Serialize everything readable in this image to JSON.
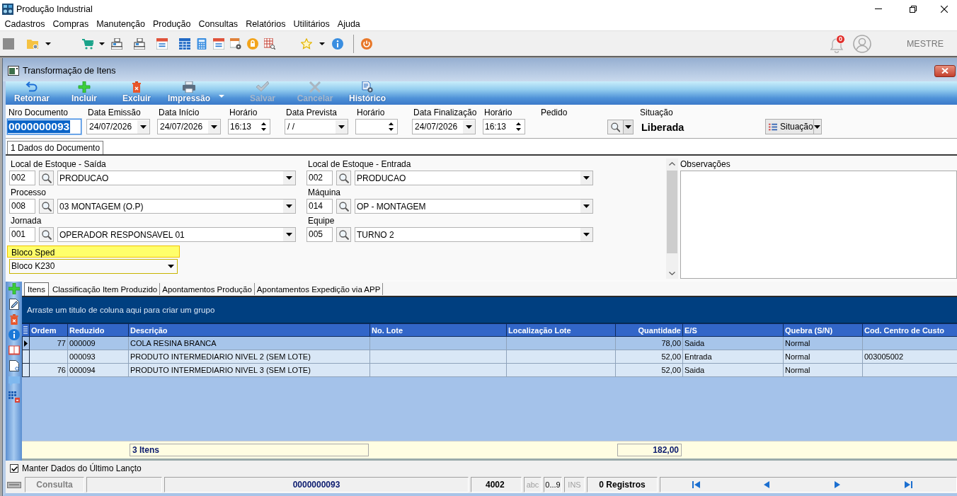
{
  "window": {
    "title": "Produção Industrial"
  },
  "menu": [
    "Cadastros",
    "Compras",
    "Manutenção",
    "Produção",
    "Consultas",
    "Relatórios",
    "Utilitários",
    "Ajuda"
  ],
  "user_area": {
    "notification_count": "0",
    "user_name": "MESTRE"
  },
  "document_window": {
    "title": "Transformação de Itens",
    "actions": [
      {
        "kind": "return",
        "label": "Retornar",
        "disabled": false,
        "dropdown": false
      },
      {
        "kind": "add",
        "label": "Incluir",
        "disabled": false,
        "dropdown": false
      },
      {
        "kind": "delete",
        "label": "Excluir",
        "disabled": false,
        "dropdown": false
      },
      {
        "kind": "print",
        "label": "Impressão",
        "disabled": false,
        "dropdown": true
      },
      {
        "kind": "save",
        "label": "Salvar",
        "disabled": true,
        "dropdown": false
      },
      {
        "kind": "cancel",
        "label": "Cancelar",
        "disabled": true,
        "dropdown": false
      },
      {
        "kind": "history",
        "label": "Histórico",
        "disabled": false,
        "dropdown": false
      }
    ]
  },
  "header": {
    "fields": [
      {
        "kind": "text",
        "label": "Nro Documento",
        "value": "0000000093",
        "focused": true
      },
      {
        "kind": "date",
        "label": "Data Emissão",
        "value": "24/07/2026",
        "focused": false
      },
      {
        "kind": "date",
        "label": "Data Início",
        "value": "24/07/2026",
        "focused": false
      },
      {
        "kind": "time",
        "label": "Horário",
        "value": "16:13",
        "focused": false
      },
      {
        "kind": "date",
        "label": "Data Prevista",
        "value": "/ /",
        "focused": false
      },
      {
        "kind": "time",
        "label": "Horário",
        "focused": false
      },
      {
        "kind": "date",
        "label": "Data Finalização",
        "value": "24/07/2026",
        "focused": false
      },
      {
        "kind": "time",
        "label": "Horário",
        "value": "16:13",
        "focused": false
      }
    ],
    "pedido": {
      "label": "Pedido"
    },
    "situacao": {
      "label": "Situação",
      "value": "Liberada"
    },
    "situacao_button": {
      "label": "Situação"
    }
  },
  "tabs": [
    {
      "label": "1 Dados do Documento",
      "selected": true
    }
  ],
  "form": {
    "fields": [
      {
        "label": "Local de Estoque - Saída",
        "code": "002",
        "value": "PRODUCAO"
      },
      {
        "label": "Local de Estoque - Entrada",
        "code": "002",
        "value": "PRODUCAO"
      },
      {
        "label": "Processo",
        "code": "008",
        "value": "03 MONTAGEM (O.P)"
      },
      {
        "label": "Máquina",
        "code": "014",
        "value": "OP - MONTAGEM"
      },
      {
        "label": "Jornada",
        "code": "001",
        "value": "OPERADOR RESPONSAVEL 01"
      },
      {
        "label": "Equipe",
        "code": "005",
        "value": "TURNO 2"
      }
    ],
    "bloco_sped": {
      "label": "Bloco Sped",
      "value": "Bloco K230",
      "highlighted": true
    },
    "observacoes": {
      "label": "Observações"
    }
  },
  "item_tabs": [
    {
      "label": "Itens",
      "selected": true
    },
    {
      "label": "Classificação Item Produzido",
      "selected": false
    },
    {
      "label": "Apontamentos Produção",
      "selected": false
    },
    {
      "label": "Apontamentos Expedição via APP",
      "selected": false
    }
  ],
  "grid": {
    "group_hint": "Arraste um titulo de coluna aqui para criar um grupo",
    "columns": [
      {
        "label": "Ordem",
        "kind": "integer"
      },
      {
        "label": "Reduzido",
        "kind": "text"
      },
      {
        "label": "Descrição",
        "kind": "text"
      },
      {
        "label": "No. Lote",
        "kind": "text"
      },
      {
        "label": "Localização Lote",
        "kind": "text"
      },
      {
        "label": "Quantidade",
        "kind": "decimal"
      },
      {
        "label": "E/S",
        "kind": "text"
      },
      {
        "label": "Quebra (S/N)",
        "kind": "text"
      },
      {
        "label": "Cod. Centro de Custo",
        "kind": "text"
      }
    ],
    "rows": [
      {
        "selected": true,
        "ordem": "77",
        "reduzido": "000009",
        "descricao": "COLA RESINA BRANCA",
        "quantidade": "78,00",
        "e_s": "Saida",
        "quebra_s_n": "Normal"
      },
      {
        "selected": false,
        "reduzido": "000093",
        "descricao": "PRODUTO INTERMEDIARIO NIVEL 2 (SEM LOTE)",
        "quantidade": "52,00",
        "e_s": "Entrada",
        "quebra_s_n": "Normal",
        "cod_centro_de_custo": "003005002"
      },
      {
        "selected": false,
        "ordem": "76",
        "reduzido": "000094",
        "descricao": "PRODUTO INTERMEDIARIO NIVEL 3 (SEM LOTE)",
        "quantidade": "52,00",
        "e_s": "Saida",
        "quebra_s_n": "Normal"
      }
    ],
    "footer": {
      "count": "3 Itens",
      "quantity_total": "182,00"
    }
  },
  "keep_last_data": {
    "label": "Manter Dados do Último Lançto",
    "checked": true
  },
  "status_bar": {
    "mode": "Consulta",
    "document": "0000000093",
    "code": "4002",
    "indicators": [
      {
        "label": "abc",
        "on": false
      },
      {
        "label": "0...9",
        "on": true
      },
      {
        "label": "INS",
        "on": false
      }
    ],
    "records": "0 Registros"
  }
}
